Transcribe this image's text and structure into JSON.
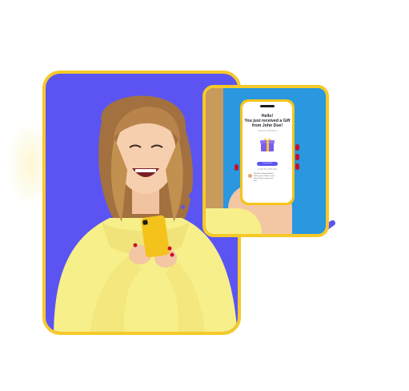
{
  "hero": {
    "notification": {
      "greeting": "Hello!",
      "line2": "You just received a Gift",
      "line3": "from John Doe!",
      "subtext": "Choose a Gift below",
      "cta_label": "Unwrap Gift",
      "sender_label": "A GIFT BY JOHN DOE",
      "message_text": "Hello Ana! Happy Birthday! Wishing you a fabulous year filled with joy, laughter and love."
    }
  },
  "colors": {
    "brand_purple": "#5b54f3",
    "accent_yellow": "#f6c928",
    "inset_blue": "#2a97df",
    "hoodie_yellow": "#f7ef8a"
  },
  "icons": {
    "gift": "gift-icon"
  }
}
